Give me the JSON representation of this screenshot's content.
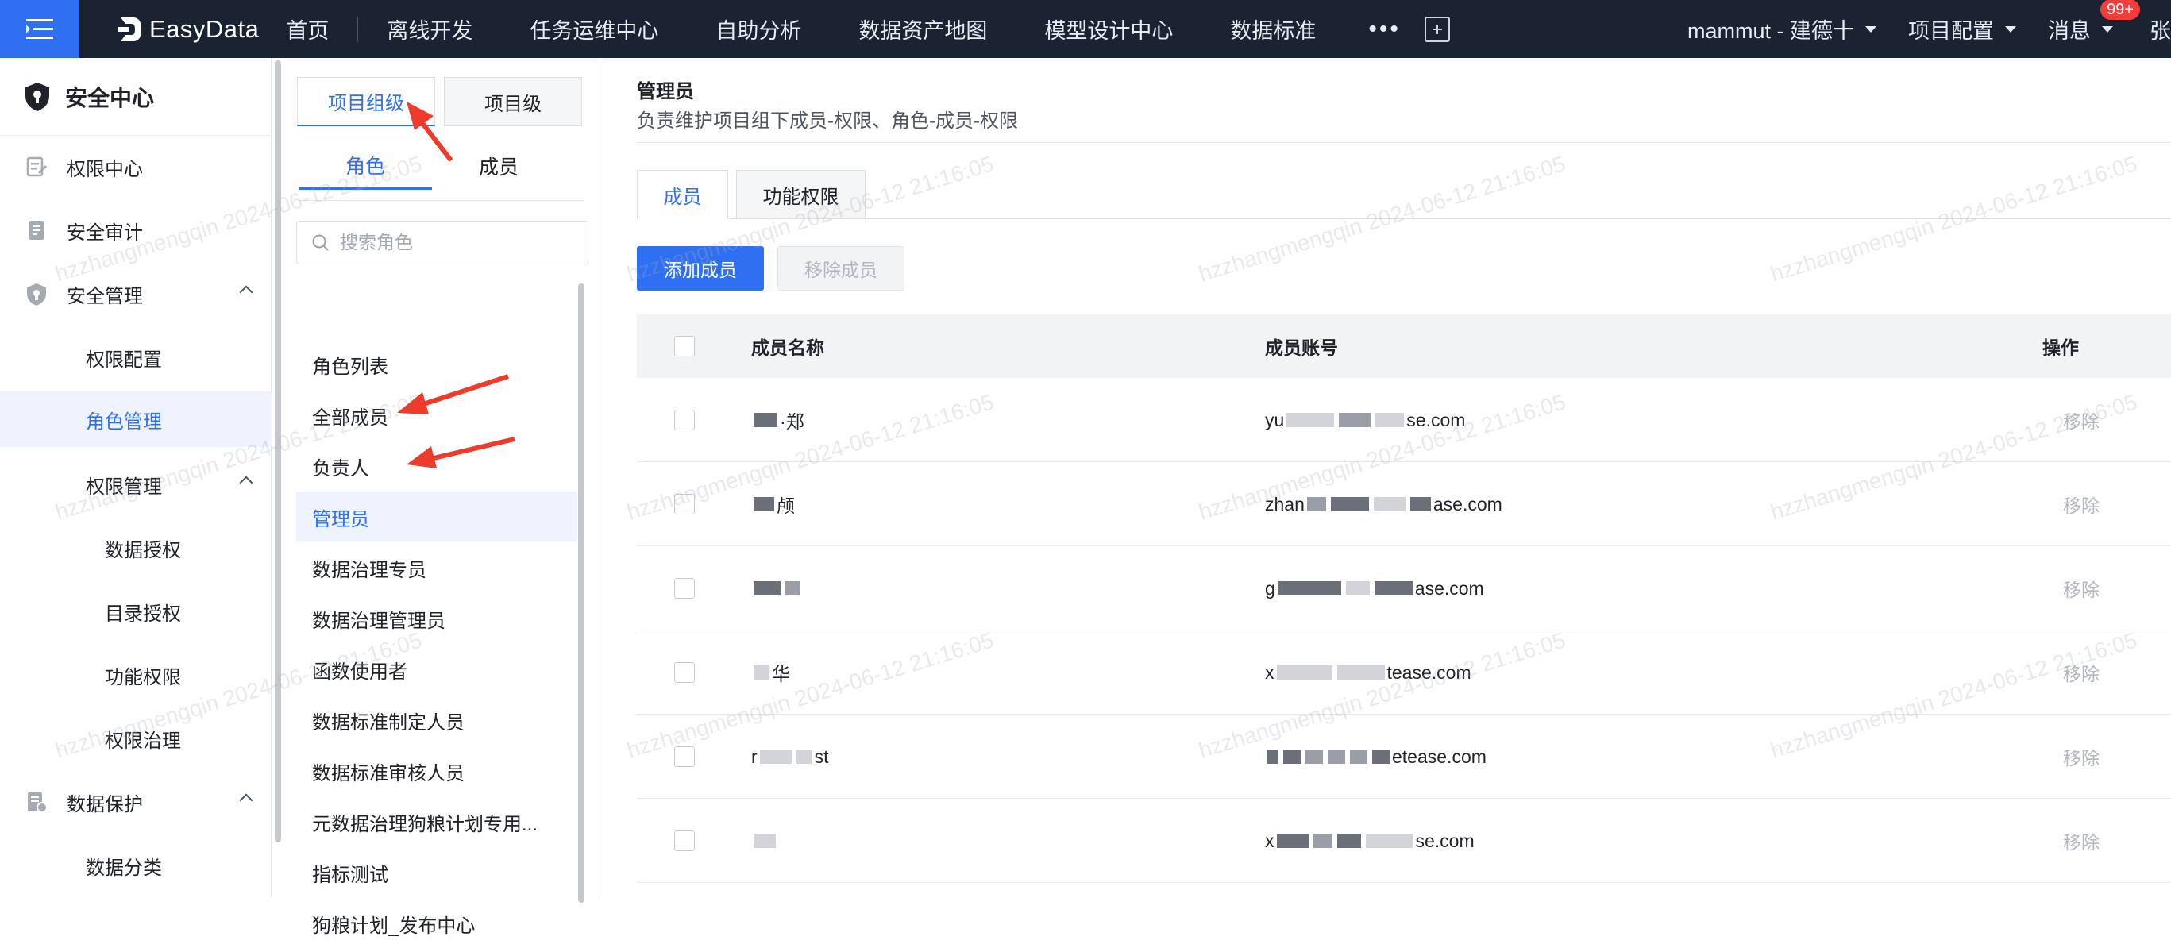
{
  "topbar": {
    "logo_text": "EasyData",
    "nav": [
      "首页",
      "离线开发",
      "任务运维中心",
      "自助分析",
      "数据资产地图",
      "模型设计中心",
      "数据标准"
    ],
    "more": "•••",
    "project": "mammut - 建德十",
    "project_config": "项目配置",
    "messages": "消息",
    "message_badge": "99+",
    "user": "张"
  },
  "sidebar": {
    "title": "安全中心",
    "items": [
      {
        "label": "权限中心",
        "icon": "permission-center-icon"
      },
      {
        "label": "安全审计",
        "icon": "audit-icon"
      },
      {
        "label": "安全管理",
        "icon": "shield-icon"
      },
      {
        "label": "权限配置"
      },
      {
        "label": "角色管理"
      },
      {
        "label": "权限管理"
      },
      {
        "label": "数据授权"
      },
      {
        "label": "目录授权"
      },
      {
        "label": "功能权限"
      },
      {
        "label": "权限治理"
      },
      {
        "label": "数据保护",
        "icon": "data-protect-icon"
      },
      {
        "label": "数据分类"
      }
    ]
  },
  "middle": {
    "segments": [
      "项目组级",
      "项目级"
    ],
    "subtabs": [
      "角色",
      "成员"
    ],
    "search_placeholder": "搜索角色",
    "roles": [
      "角色列表",
      "全部成员",
      "负责人",
      "管理员",
      "数据治理专员",
      "数据治理管理员",
      "函数使用者",
      "数据标准制定人员",
      "数据标准审核人员",
      "元数据治理狗粮计划专用...",
      "指标测试",
      "狗粮计划_发布中心"
    ]
  },
  "main": {
    "title": "管理员",
    "description": "负责维护项目组下成员-权限、角色-成员-权限",
    "tabs": [
      "成员",
      "功能权限"
    ],
    "add_button": "添加成员",
    "remove_button": "移除成员",
    "columns": [
      "成员名称",
      "成员账号",
      "操作"
    ],
    "rows": [
      {
        "name_head": "",
        "name_tail": "·郑",
        "account_head": "yu",
        "account_tail": "se.com",
        "action": "移除"
      },
      {
        "name_head": "",
        "name_tail": "颅",
        "account_head": "zhan",
        "account_tail": "ase.com",
        "action": "移除"
      },
      {
        "name_head": "",
        "name_tail": "",
        "account_head": "g",
        "account_tail": "ase.com",
        "action": "移除"
      },
      {
        "name_head": "",
        "name_tail": "华",
        "account_head": "x",
        "account_tail": "tease.com",
        "action": "移除"
      },
      {
        "name_head": "r",
        "name_tail": "st",
        "account_head": "",
        "account_tail": "etease.com",
        "action": "移除"
      },
      {
        "name_head": "",
        "name_tail": "",
        "account_head": "x",
        "account_tail": "se.com",
        "action": "移除"
      }
    ]
  },
  "watermark": "hzzhangmengqin 2024-06-12 21:16:05",
  "colors": {
    "accent": "#2f6ff2",
    "topbar": "#1b2333",
    "annotation_arrow": "#ee3b2b"
  }
}
